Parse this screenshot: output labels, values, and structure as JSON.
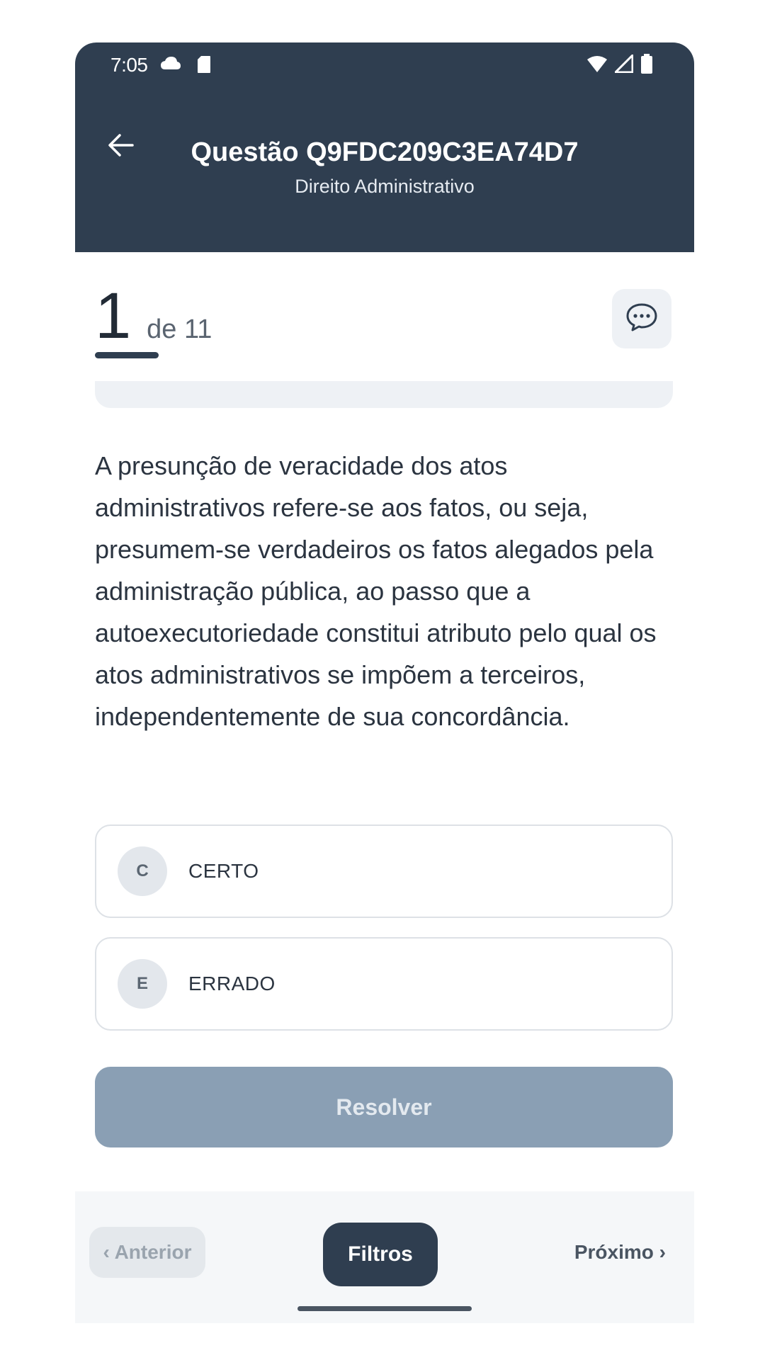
{
  "status_bar": {
    "time": "7:05",
    "icons_left": [
      "cloud-icon",
      "sd-card-icon"
    ],
    "icons_right": [
      "wifi-icon",
      "signal-icon",
      "battery-icon"
    ]
  },
  "header": {
    "title": "Questão Q9FDC209C3EA74D7",
    "subtitle": "Direito Administrativo",
    "back_icon": "arrow-left-icon",
    "background_color": "#2f3e50"
  },
  "counter": {
    "current": "1",
    "total_label": "de 11"
  },
  "comment_button": {
    "icon": "chat-bubble-icon"
  },
  "question": {
    "text": "A presunção de veracidade dos atos administrativos refere-se aos fatos, ou seja, presumem-se verdadeiros os fatos alegados pela administração pública, ao passo que a autoexecutoriedade constitui atributo pelo qual os atos administrativos se impõem a terceiros, independentemente de sua concordância."
  },
  "options": [
    {
      "letter": "C",
      "label": "CERTO"
    },
    {
      "letter": "E",
      "label": "ERRADO"
    }
  ],
  "resolve_button": {
    "label": "Resolver",
    "color": "#8a9fb4"
  },
  "bottom_nav": {
    "prev_label": "‹ Anterior",
    "filters_label": "Filtros",
    "next_label": "Próximo ›"
  }
}
